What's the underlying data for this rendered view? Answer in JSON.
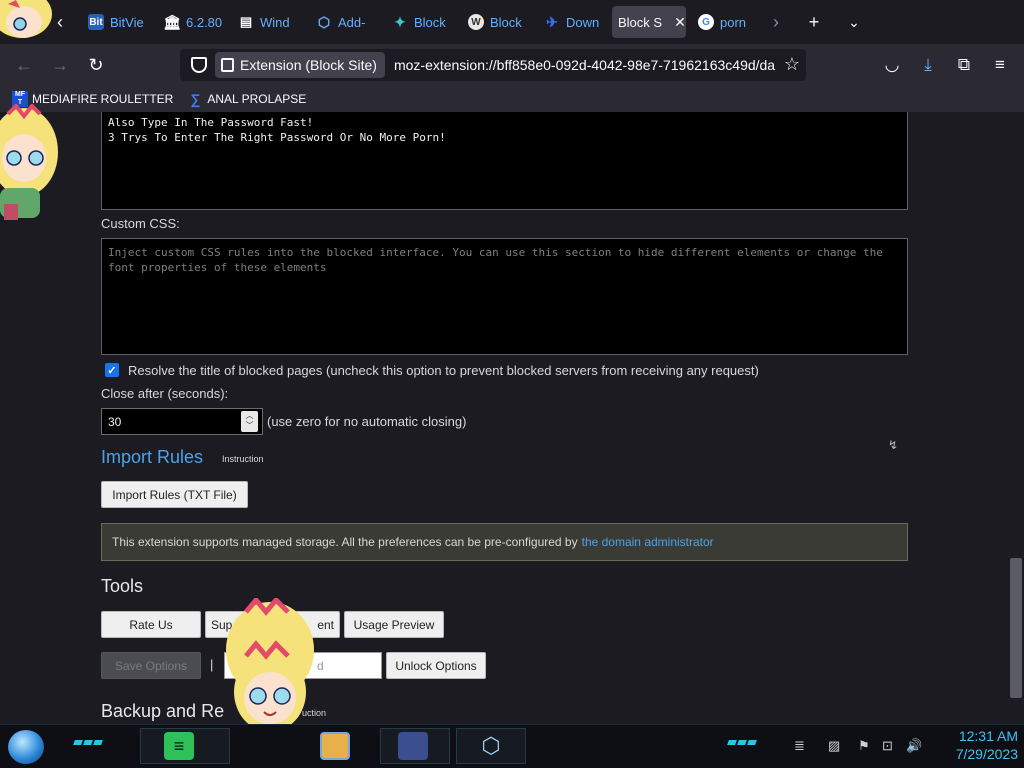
{
  "browser": {
    "tabs": [
      {
        "label": "BitVie",
        "fav_text": "Bit",
        "fav_color": "#2b5fb8"
      },
      {
        "label": "6.2.80",
        "fav_text": "🏛",
        "fav_color": "#1c1b22"
      },
      {
        "label": "Wind",
        "fav_text": "▤",
        "fav_color": "#1c1b22"
      },
      {
        "label": "Add-",
        "fav_text": "⬡",
        "fav_color": "#1c1b22"
      },
      {
        "label": "Block",
        "fav_text": "✦",
        "fav_color": "#1c1b22"
      },
      {
        "label": "Block",
        "fav_text": "W",
        "fav_color": "#e8e8e8"
      },
      {
        "label": "Down",
        "fav_text": "✈",
        "fav_color": "#1c1b22"
      },
      {
        "label": "Block S",
        "fav_text": "",
        "fav_color": "#42414d",
        "active": true
      },
      {
        "label": "porn",
        "fav_text": "G",
        "fav_color": "#ffffff"
      }
    ],
    "url_pill": "Extension (Block Site)",
    "url": "moz-extension://bff858e0-092d-4042-98e7-71962163c49d/da",
    "bookmarks": [
      {
        "label": "MEDIAFIRE ROULETTER",
        "icon": "MF T"
      },
      {
        "label": "ANAL PROLAPSE",
        "icon": "∑"
      }
    ]
  },
  "page": {
    "message_text": "Also Type In The Password Fast!\n3 Trys To Enter The Right Password Or No More Porn!",
    "custom_css_label": "Custom CSS:",
    "custom_css_placeholder": "Inject custom CSS rules into the blocked interface. You can use this section to hide different elements or change the font properties of these elements",
    "resolve_checked": true,
    "resolve_label": "Resolve the title of blocked pages (uncheck this option to prevent blocked servers from receiving any request)",
    "close_after_label": "Close after (seconds):",
    "close_after_value": "30",
    "close_after_hint": "(use zero for no automatic closing)",
    "import_heading": "Import Rules",
    "import_instruction": "Instruction",
    "import_button": "Import Rules (TXT File)",
    "notice_text": "This extension supports managed storage. All the preferences can be pre-configured by",
    "notice_link": "the domain administrator",
    "tools_heading": "Tools",
    "rate_button": "Rate Us",
    "support_button_left": "Sup",
    "support_button_right": "ent",
    "usage_button": "Usage Preview",
    "save_button": "Save Options",
    "separator": "|",
    "password_placeholder_tail": "d",
    "unlock_button": "Unlock Options",
    "backup_heading": "Backup and Re",
    "backup_instruction_tail": "uction"
  },
  "taskbar": {
    "time": "12:31 AM",
    "date": "7/29/2023"
  }
}
